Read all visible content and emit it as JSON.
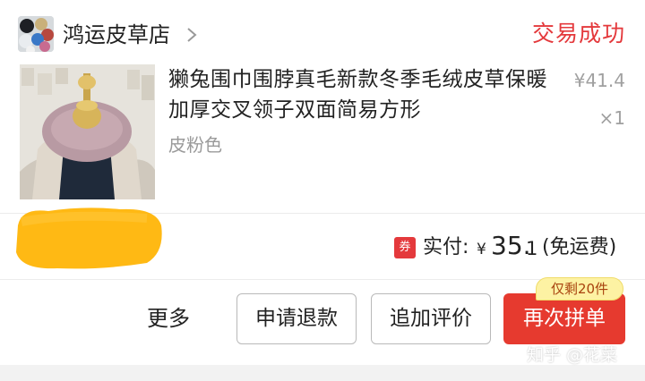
{
  "shop": {
    "name": "鸿运皮草店",
    "chevron_icon": "chevron-right-icon"
  },
  "order": {
    "status": "交易成功",
    "status_color": "#e4393c"
  },
  "product": {
    "title": "獭兔围巾围脖真毛新款冬季毛绒皮草保暖加厚交叉领子双面简易方形",
    "variant": "皮粉色",
    "unit_price": "¥41.4",
    "quantity": "×1"
  },
  "payment": {
    "coupon_icon": "券",
    "paid_label": "实付:",
    "currency": "¥",
    "amount_int": "35.",
    "amount_dec": "1",
    "shipping_note": "(免运费)"
  },
  "actions": {
    "more": "更多",
    "refund": "申请退款",
    "add_review": "追加评价",
    "rebuy": "再次拼单",
    "stock_badge": "仅剩20件"
  },
  "colors": {
    "accent": "#e63a2f",
    "badge_bg": "#fdf2a3",
    "redaction": "#ffb300"
  },
  "watermark": "知乎 @花菜"
}
